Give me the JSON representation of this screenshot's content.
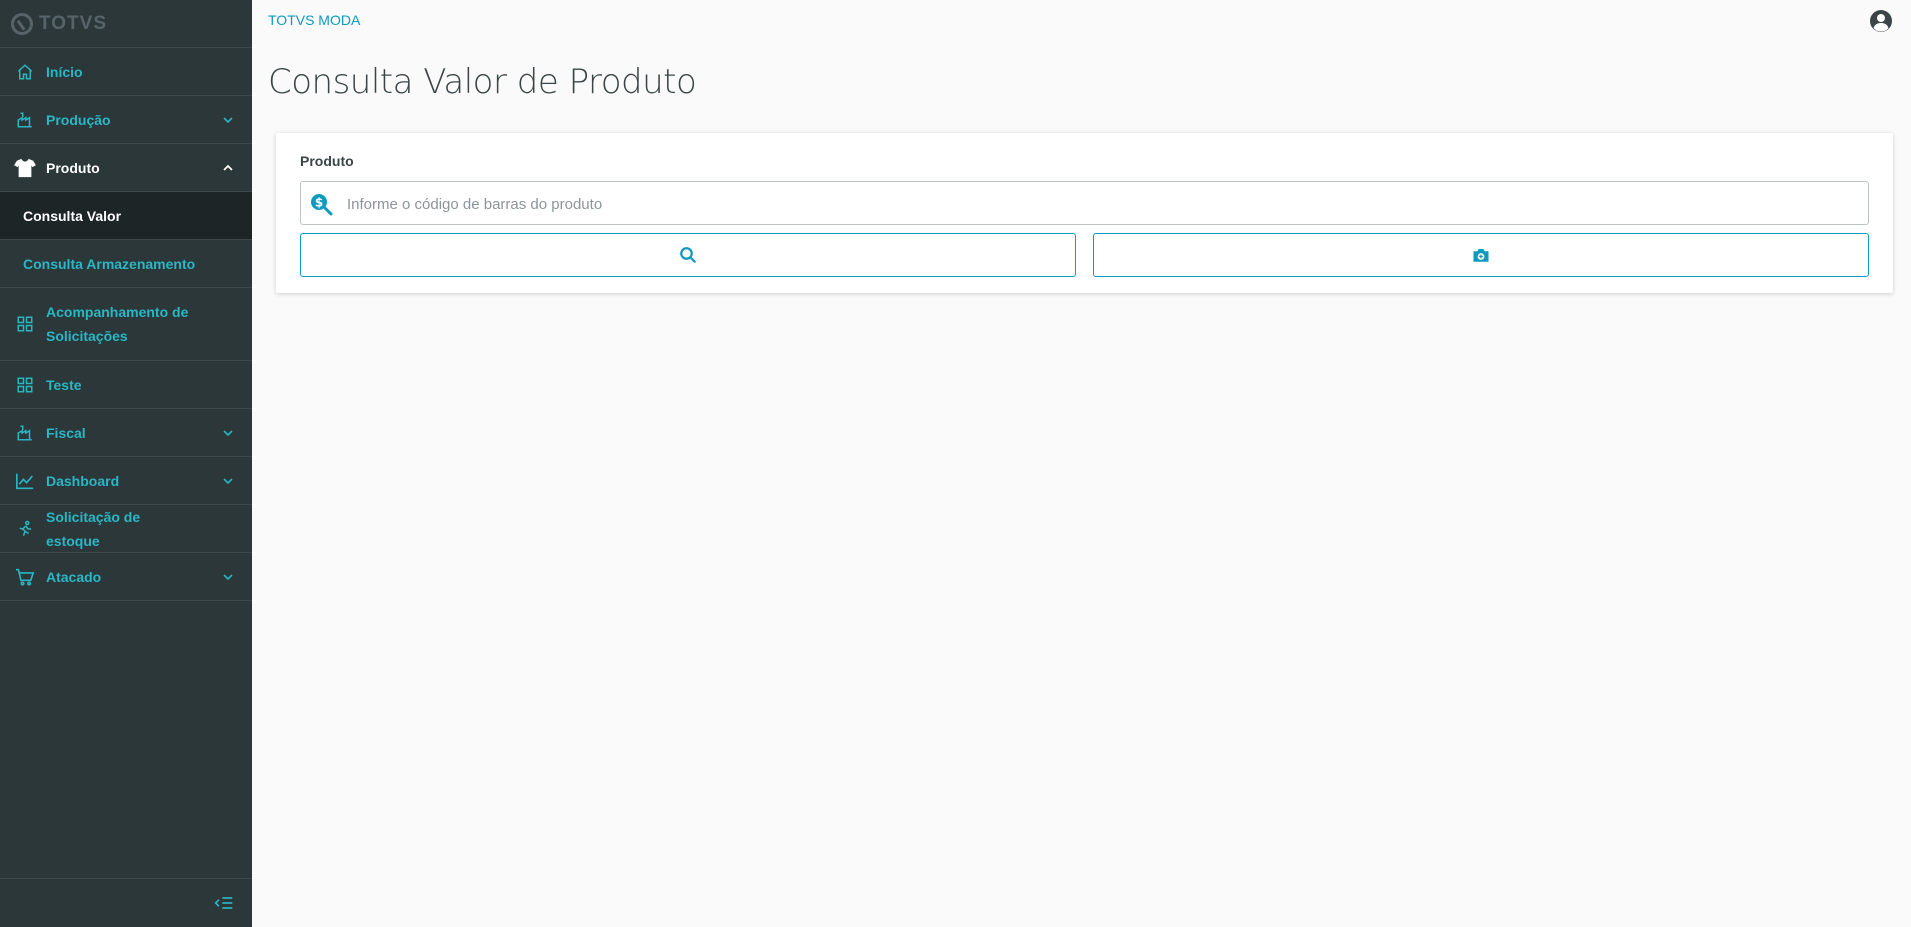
{
  "brand": {
    "logo_text": "TOTVS"
  },
  "sidebar": {
    "items": [
      {
        "label": "Início",
        "icon": "home-icon"
      },
      {
        "label": "Produção",
        "icon": "factory-icon",
        "expandable": true
      },
      {
        "label": "Produto",
        "icon": "shirt-icon",
        "expandable": true,
        "expanded": true
      },
      {
        "label": "Acompanhamento de Solicitações",
        "icon": "grid-icon"
      },
      {
        "label": "Teste",
        "icon": "grid-icon"
      },
      {
        "label": "Fiscal",
        "icon": "factory-icon",
        "expandable": true
      },
      {
        "label": "Dashboard",
        "icon": "chart-line-icon",
        "expandable": true
      },
      {
        "label": "Solicitação de estoque",
        "icon": "running-person-icon"
      },
      {
        "label": "Atacado",
        "icon": "cart-icon",
        "expandable": true
      }
    ],
    "subitems": [
      {
        "label": "Consulta Valor",
        "active": true
      },
      {
        "label": "Consulta Armazenamento",
        "active": false
      }
    ],
    "collapse_icon": "collapse-menu-icon"
  },
  "header": {
    "app_name": "TOTVS MODA",
    "user_icon": "user-icon"
  },
  "page": {
    "title": "Consulta Valor de Produto",
    "field_label": "Produto",
    "input_placeholder": "Informe o código de barras do produto",
    "input_value": "",
    "search_button_icon": "search-icon",
    "camera_button_icon": "camera-icon"
  },
  "colors": {
    "sidebar_bg": "#2c3739",
    "accent": "#0c9abe",
    "menu_text": "#29b6c5",
    "active_bg": "#1d2527"
  }
}
